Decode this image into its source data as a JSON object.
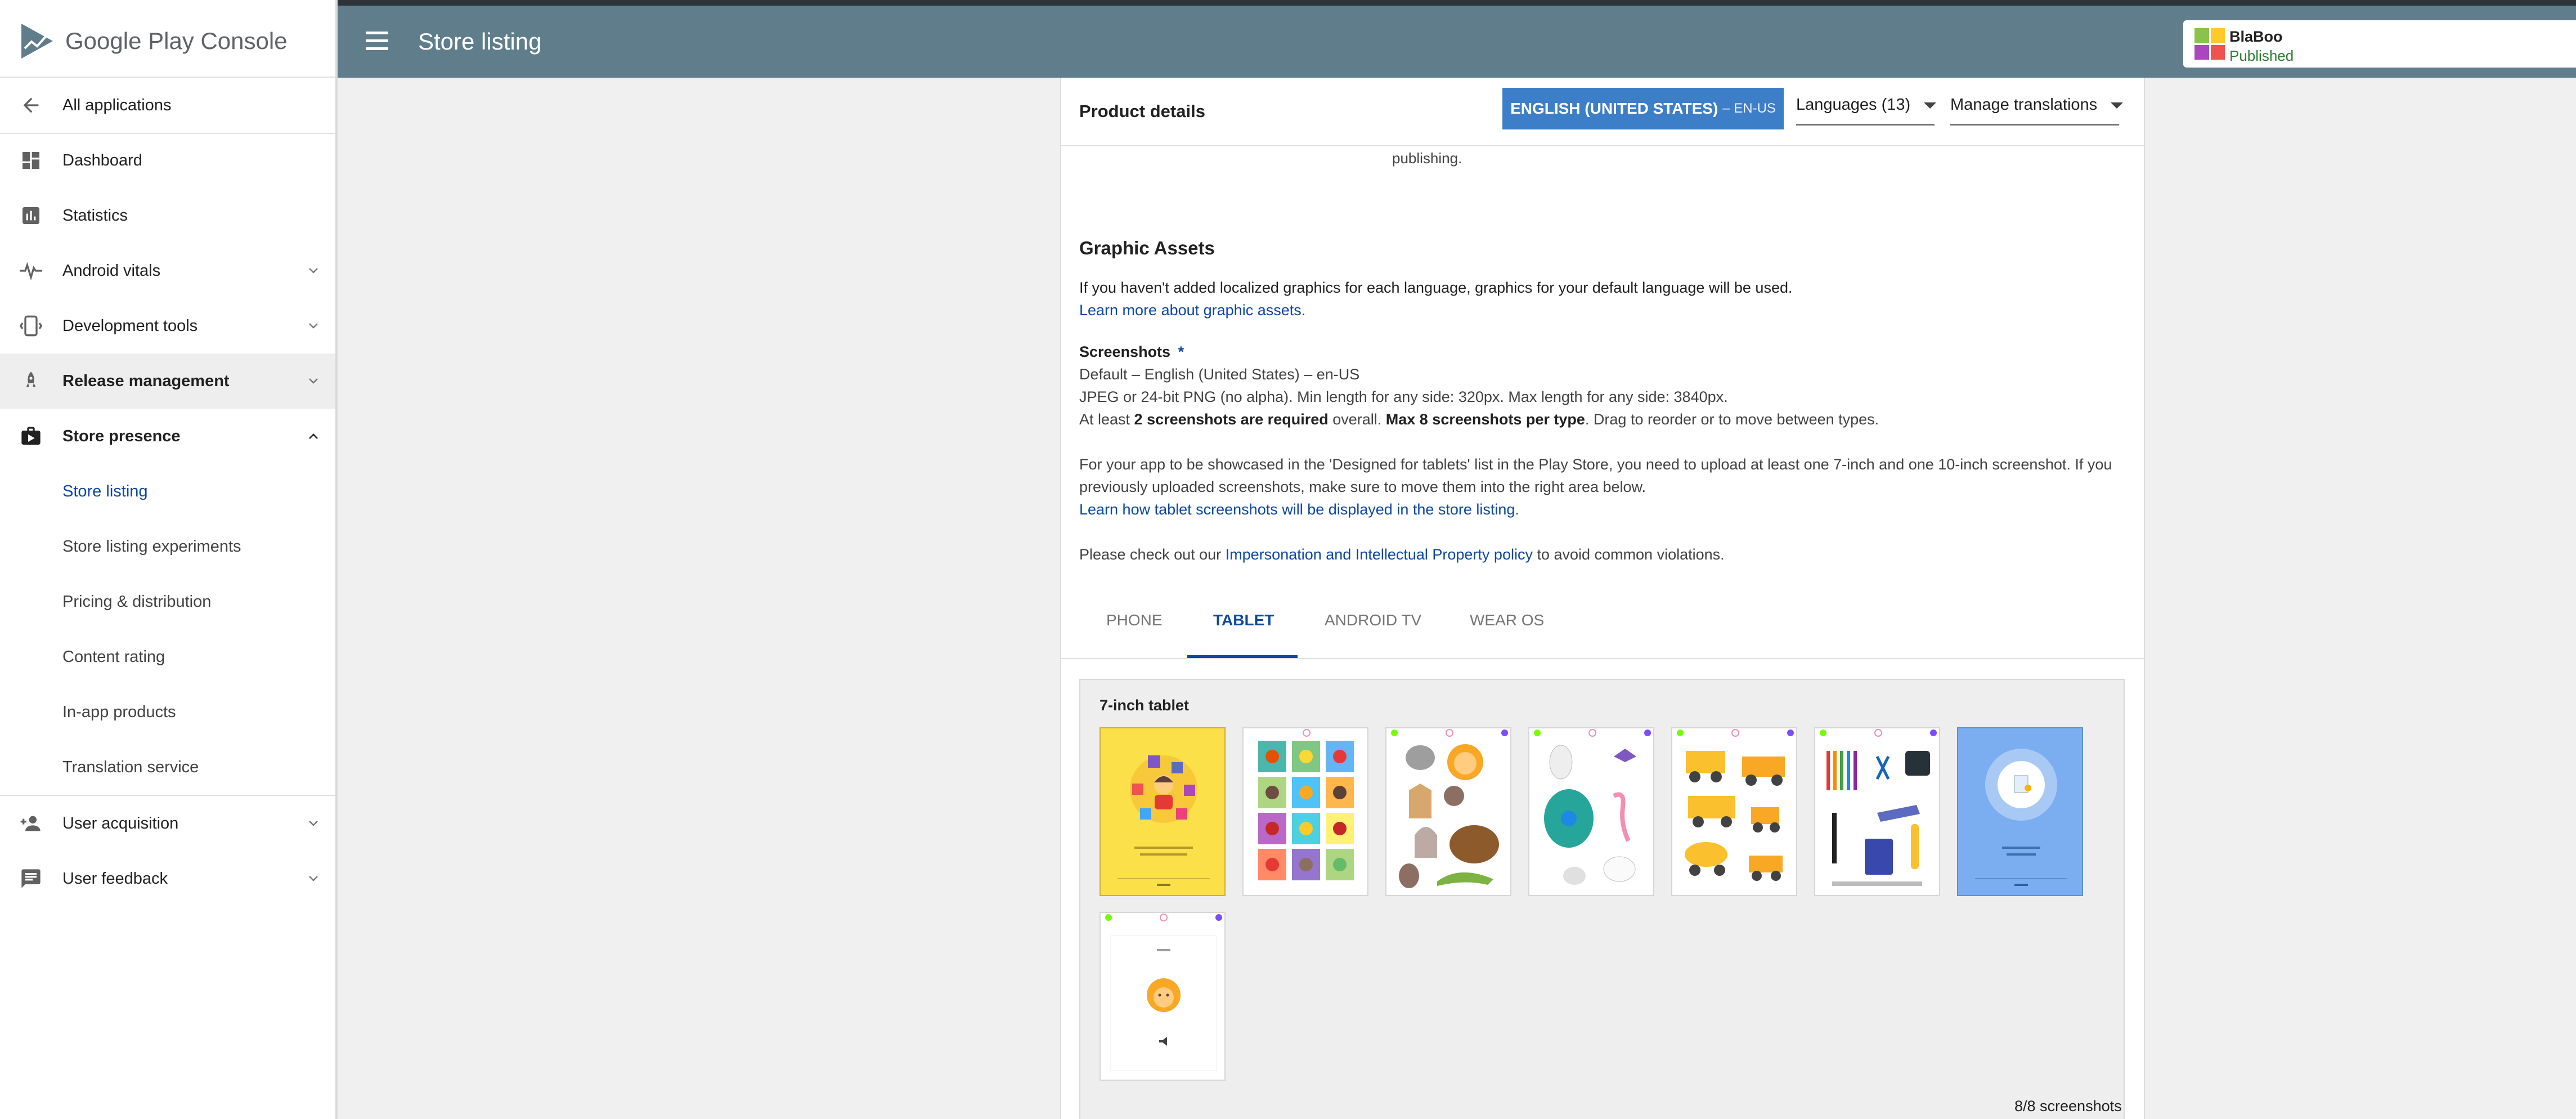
{
  "logo": {
    "text": "Google Play Console"
  },
  "sidebar": {
    "items": [
      {
        "label": "All applications",
        "icon": "arrow-left-icon"
      },
      {
        "label": "Dashboard",
        "icon": "dashboard-icon"
      },
      {
        "label": "Statistics",
        "icon": "bar-chart-icon"
      },
      {
        "label": "Android vitals",
        "icon": "pulse-icon"
      },
      {
        "label": "Development tools",
        "icon": "phone-tools-icon"
      },
      {
        "label": "Release management",
        "icon": "rocket-icon"
      },
      {
        "label": "Store presence",
        "icon": "shopping-bag-icon"
      },
      {
        "label": "User acquisition",
        "icon": "add-user-icon"
      },
      {
        "label": "User feedback",
        "icon": "feedback-icon"
      }
    ],
    "store_presence_sub": [
      {
        "label": "Store listing"
      },
      {
        "label": "Store listing experiments"
      },
      {
        "label": "Pricing & distribution"
      },
      {
        "label": "Content rating"
      },
      {
        "label": "In-app products"
      },
      {
        "label": "Translation service"
      }
    ]
  },
  "header": {
    "title": "Store listing"
  },
  "app": {
    "name": "BlaBoo",
    "status": "Published"
  },
  "product": {
    "title": "Product details",
    "language_button": {
      "name": "ENGLISH (UNITED STATES)",
      "code": "– EN-US"
    },
    "languages_dropdown": "Languages (13)",
    "translations_dropdown": "Manage translations",
    "cut_text": "publishing."
  },
  "graphic_assets": {
    "title": "Graphic Assets",
    "intro": "If you haven't added localized graphics for each language, graphics for your default language will be used.",
    "learn_link": "Learn more about graphic assets.",
    "screenshots_label": "Screenshots",
    "required_mark": "*",
    "default_line": "Default – English (United States) – en-US",
    "format_line": "JPEG or 24-bit PNG (no alpha). Min length for any side: 320px. Max length for any side: 3840px.",
    "atleast_prefix": "At least ",
    "atleast_bold1": "2 screenshots are required",
    "atleast_mid": " overall. ",
    "atleast_bold2": "Max 8 screenshots per type",
    "atleast_suffix": ". Drag to reorder or to move between types.",
    "tablet_line1": "For your app to be showcased in the 'Designed for tablets' list in the Play Store, you need to upload at least one 7-inch and one 10-inch screenshot. If you",
    "tablet_line2": "previously uploaded screenshots, make sure to move them into the right area below.",
    "tablet_link": "Learn how tablet screenshots will be displayed in the store listing.",
    "policy_prefix": "Please check out our ",
    "policy_link": "Impersonation and Intellectual Property policy",
    "policy_suffix": " to avoid common violations."
  },
  "tabs": [
    {
      "label": "PHONE"
    },
    {
      "label": "TABLET"
    },
    {
      "label": "ANDROID TV"
    },
    {
      "label": "WEAR OS"
    }
  ],
  "active_tab": "TABLET",
  "panel": {
    "title": "7-inch tablet",
    "count_text": "8/8 screenshots",
    "screenshots": [
      {
        "theme": "yellow-kids-intro"
      },
      {
        "theme": "icon-grid"
      },
      {
        "theme": "animals"
      },
      {
        "theme": "birds"
      },
      {
        "theme": "construction-vehicles"
      },
      {
        "theme": "school-supplies"
      },
      {
        "theme": "blue-intro"
      },
      {
        "theme": "lion-card"
      }
    ]
  },
  "colors": {
    "header": "#607d8b",
    "accent": "#3d7ec8",
    "link": "#0d47a1",
    "published": "#2e7d32"
  }
}
